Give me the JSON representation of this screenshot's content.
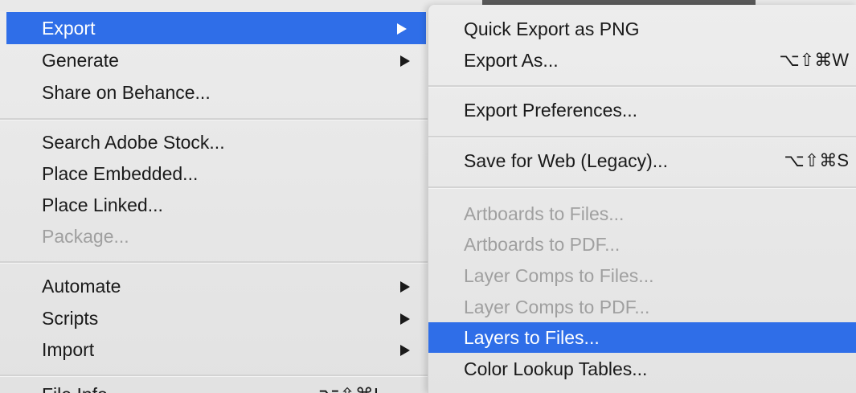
{
  "main_menu": {
    "items": [
      {
        "label": "Export",
        "has_submenu": true,
        "highlighted": true,
        "disabled": false
      },
      {
        "label": "Generate",
        "has_submenu": true,
        "highlighted": false,
        "disabled": false
      },
      {
        "label": "Share on Behance...",
        "has_submenu": false,
        "highlighted": false,
        "disabled": false
      },
      {
        "label": "Search Adobe Stock...",
        "has_submenu": false,
        "highlighted": false,
        "disabled": false
      },
      {
        "label": "Place Embedded...",
        "has_submenu": false,
        "highlighted": false,
        "disabled": false
      },
      {
        "label": "Place Linked...",
        "has_submenu": false,
        "highlighted": false,
        "disabled": false
      },
      {
        "label": "Package...",
        "has_submenu": false,
        "highlighted": false,
        "disabled": true
      },
      {
        "label": "Automate",
        "has_submenu": true,
        "highlighted": false,
        "disabled": false
      },
      {
        "label": "Scripts",
        "has_submenu": true,
        "highlighted": false,
        "disabled": false
      },
      {
        "label": "Import",
        "has_submenu": true,
        "highlighted": false,
        "disabled": false
      }
    ],
    "cut_off_item": {
      "label": "File Info...",
      "shortcut": "⌥⇧⌘I"
    }
  },
  "export_submenu": {
    "items": [
      {
        "label": "Quick Export as PNG",
        "shortcut": "",
        "highlighted": false,
        "disabled": false
      },
      {
        "label": "Export As...",
        "shortcut": "⌥⇧⌘W",
        "highlighted": false,
        "disabled": false
      },
      {
        "label": "Export Preferences...",
        "shortcut": "",
        "highlighted": false,
        "disabled": false
      },
      {
        "label": "Save for Web (Legacy)...",
        "shortcut": "⌥⇧⌘S",
        "highlighted": false,
        "disabled": false
      },
      {
        "label": "Artboards to Files...",
        "shortcut": "",
        "highlighted": false,
        "disabled": true
      },
      {
        "label": "Artboards to PDF...",
        "shortcut": "",
        "highlighted": false,
        "disabled": true
      },
      {
        "label": "Layer Comps to Files...",
        "shortcut": "",
        "highlighted": false,
        "disabled": true
      },
      {
        "label": "Layer Comps to PDF...",
        "shortcut": "",
        "highlighted": false,
        "disabled": true
      },
      {
        "label": "Layers to Files...",
        "shortcut": "",
        "highlighted": true,
        "disabled": false
      },
      {
        "label": "Color Lookup Tables...",
        "shortcut": "",
        "highlighted": false,
        "disabled": false
      }
    ]
  },
  "colors": {
    "highlight": "#2f6ee8",
    "menu_background": "#e8e8e8",
    "text": "#1a1a1a",
    "disabled_text": "#a0a0a0"
  },
  "icons": {
    "submenu_indicator": "triangle-right-icon"
  }
}
